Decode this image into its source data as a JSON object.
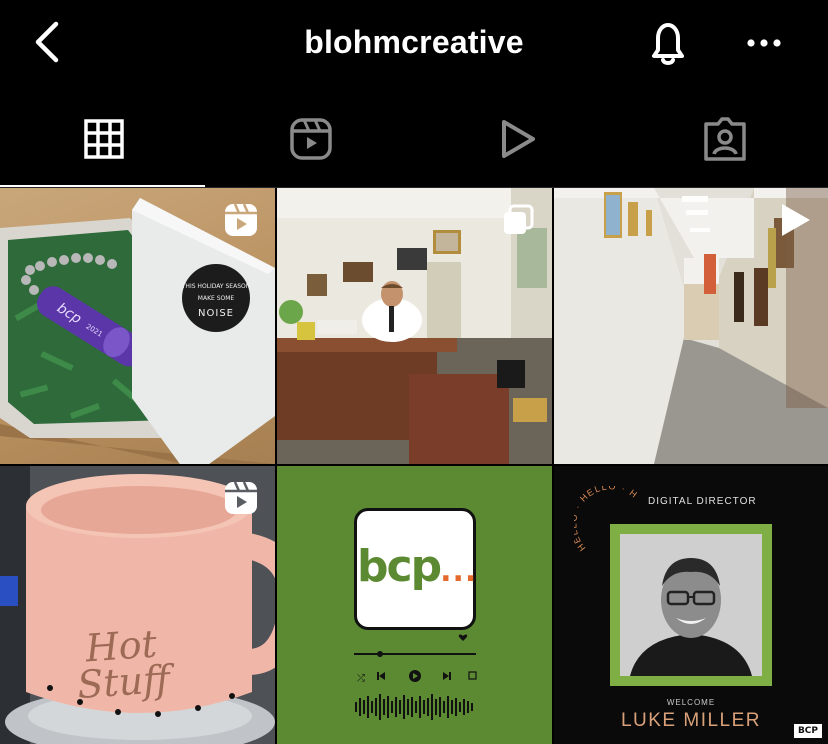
{
  "header": {
    "title": "blohmcreative",
    "back_icon": "chevron-left-icon",
    "bell_icon": "bell-icon",
    "more_icon": "more-horizontal-icon"
  },
  "tabs": [
    {
      "name": "posts",
      "icon": "grid-icon",
      "active": true
    },
    {
      "name": "reels",
      "icon": "reels-icon",
      "active": false
    },
    {
      "name": "videos",
      "icon": "play-icon",
      "active": false
    },
    {
      "name": "tagged",
      "icon": "tagged-user-icon",
      "active": false
    }
  ],
  "grid": {
    "posts": [
      {
        "badge": "reels-icon",
        "box_lid_text": "THIS HOLIDAY SEASON MAKE SOME NOISE",
        "kazoo_text": "bcp 2021"
      },
      {
        "badge": "carousel-icon"
      },
      {
        "badge": "play-icon"
      },
      {
        "badge": "reels-icon",
        "mug_text": "Hot Stuff"
      },
      {
        "badge": "",
        "logo_text": "bcp",
        "logo_dots": "..."
      },
      {
        "badge": "",
        "arc_text": "HELLO · HELLO · HELLO",
        "role": "DIGITAL DIRECTOR",
        "welcome": "WELCOME",
        "name": "LUKE MILLER",
        "tag": "BCP"
      }
    ]
  },
  "colors": {
    "background": "#000000",
    "bcp_green": "#5c8a32",
    "bcp_orange": "#e26a2c",
    "frame_green": "#7fae45",
    "name_peach": "#d9a17a"
  }
}
